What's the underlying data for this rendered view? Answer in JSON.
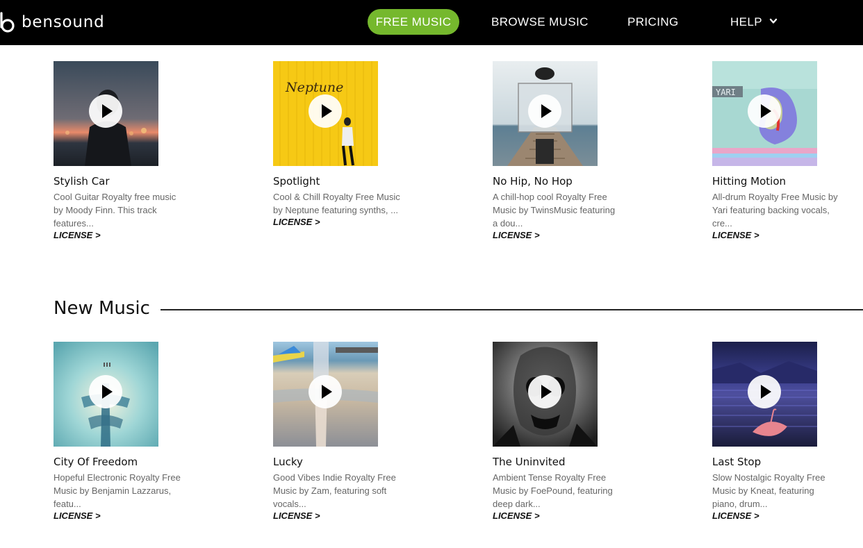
{
  "header": {
    "logo_text": "bensound",
    "nav": {
      "free_music": "FREE MUSIC",
      "browse_music": "BROWSE MUSIC",
      "pricing": "PRICING",
      "help": "HELP"
    },
    "accent_color": "#75b82d"
  },
  "top_row": [
    {
      "title": "Stylish Car",
      "desc_lines": [
        "Cool Guitar Royalty free music",
        "by Moody Finn. This track",
        "features..."
      ],
      "license": "LICENSE >",
      "art_icon": "silhouette-sunset-image"
    },
    {
      "title": "Spotlight",
      "desc_lines": [
        "Cool & Chill Royalty Free Music",
        "by Neptune featuring synths, ..."
      ],
      "license": "LICENSE >",
      "art_text": "Neptune",
      "art_icon": "yellow-wall-image"
    },
    {
      "title": "No Hip, No Hop",
      "desc_lines": [
        "A chill-hop cool Royalty Free",
        "Music by TwinsMusic featuring",
        "a dou..."
      ],
      "license": "LICENSE >",
      "art_icon": "pier-mirror-image"
    },
    {
      "title": "Hitting Motion",
      "desc_lines": [
        "All-drum Royalty Free Music by",
        "Yari featuring backing vocals,",
        "cre..."
      ],
      "license": "LICENSE >",
      "art_text": "YARI",
      "art_icon": "glitch-art-image"
    }
  ],
  "new_music": {
    "heading": "New Music",
    "items": [
      {
        "title": "City Of Freedom",
        "desc_lines": [
          "Hopeful Electronic Royalty Free",
          "Music by Benjamin Lazzarus,",
          "featu..."
        ],
        "license": "LICENSE >",
        "art_icon": "teal-abstract-image"
      },
      {
        "title": "Lucky",
        "desc_lines": [
          "Good Vibes Indie Royalty Free",
          "Music by Zam, featuring soft",
          "vocals..."
        ],
        "license": "LICENSE >",
        "art_icon": "beach-pier-image"
      },
      {
        "title": "The Uninvited",
        "desc_lines": [
          "Ambient Tense Royalty Free",
          "Music by FoePound, featuring",
          "deep dark..."
        ],
        "license": "LICENSE >",
        "art_icon": "dark-face-image"
      },
      {
        "title": "Last Stop",
        "desc_lines": [
          "Slow Nostalgic Royalty Free",
          "Music by Kneat, featuring",
          "piano, drum..."
        ],
        "license": "LICENSE >",
        "art_icon": "umbrella-night-image"
      }
    ]
  }
}
